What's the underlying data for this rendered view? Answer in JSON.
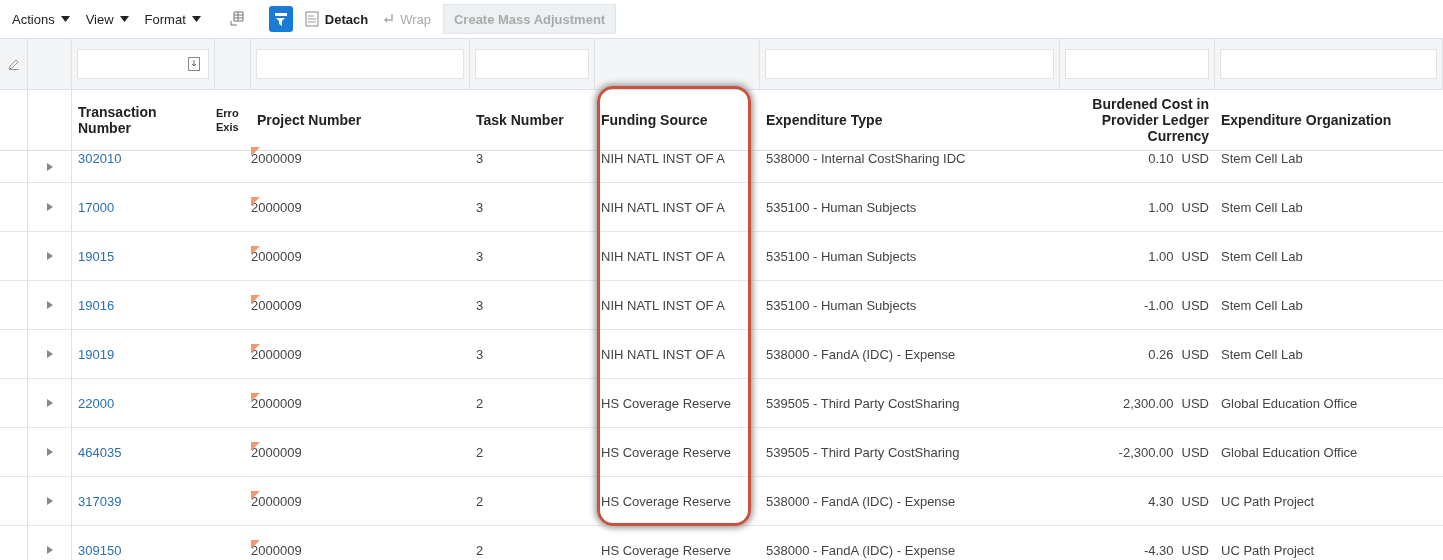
{
  "toolbar": {
    "menus": [
      {
        "label": "Actions"
      },
      {
        "label": "View"
      },
      {
        "label": "Format"
      }
    ],
    "buttons": [
      {
        "kind": "freeze"
      },
      {
        "kind": "filter",
        "selected": true
      },
      {
        "kind": "detach",
        "label": "Detach",
        "disabled": false
      },
      {
        "kind": "wrap",
        "label": "Wrap",
        "disabled": true
      },
      {
        "kind": "text",
        "label": "Create Mass Adjustment",
        "disabled": true
      }
    ]
  },
  "columns": [
    {
      "label": "Transaction Number",
      "filterable": true
    },
    {
      "label": "Erro Exis",
      "filterable": false
    },
    {
      "label": "Project Number",
      "filterable": true
    },
    {
      "label": "Task Number",
      "filterable": true
    },
    {
      "label": "Funding Source",
      "filterable": false,
      "highlighted": true
    },
    {
      "label": "Expenditure Type",
      "filterable": true
    },
    {
      "label": "Burdened Cost in Provider Ledger Currency",
      "filterable": true
    },
    {
      "label": "Expenditure Organization",
      "filterable": true
    }
  ],
  "rows": [
    {
      "transaction": "302010",
      "error": true,
      "project": "2000009",
      "task": "3",
      "funding": "NIH NATL INST OF A",
      "type": "538000 - Internal CostSharing IDC",
      "amount": "0.10",
      "currency": "USD",
      "org": "Stem Cell Lab"
    },
    {
      "transaction": "17000",
      "error": true,
      "project": "2000009",
      "task": "3",
      "funding": "NIH NATL INST OF A",
      "type": "535100 - Human Subjects",
      "amount": "1.00",
      "currency": "USD",
      "org": "Stem Cell Lab"
    },
    {
      "transaction": "19015",
      "error": true,
      "project": "2000009",
      "task": "3",
      "funding": "NIH NATL INST OF A",
      "type": "535100 - Human Subjects",
      "amount": "1.00",
      "currency": "USD",
      "org": "Stem Cell Lab"
    },
    {
      "transaction": "19016",
      "error": true,
      "project": "2000009",
      "task": "3",
      "funding": "NIH NATL INST OF A",
      "type": "535100 - Human Subjects",
      "amount": "-1.00",
      "currency": "USD",
      "org": "Stem Cell Lab"
    },
    {
      "transaction": "19019",
      "error": true,
      "project": "2000009",
      "task": "3",
      "funding": "NIH NATL INST OF A",
      "type": "538000 - FandA (IDC) - Expense",
      "amount": "0.26",
      "currency": "USD",
      "org": "Stem Cell Lab"
    },
    {
      "transaction": "22000",
      "error": true,
      "project": "2000009",
      "task": "2",
      "funding": "HS Coverage Reserve",
      "type": "539505 - Third Party CostSharing",
      "amount": "2,300.00",
      "currency": "USD",
      "org": "Global Education Office"
    },
    {
      "transaction": "464035",
      "error": true,
      "project": "2000009",
      "task": "2",
      "funding": "HS Coverage Reserve",
      "type": "539505 - Third Party CostSharing",
      "amount": "-2,300.00",
      "currency": "USD",
      "org": "Global Education Office"
    },
    {
      "transaction": "317039",
      "error": true,
      "project": "2000009",
      "task": "2",
      "funding": "HS Coverage Reserve",
      "type": "538000 - FandA (IDC) - Expense",
      "amount": "4.30",
      "currency": "USD",
      "org": "UC Path Project"
    },
    {
      "transaction": "309150",
      "error": true,
      "project": "2000009",
      "task": "2",
      "funding": "HS Coverage Reserve",
      "type": "538000 - FandA (IDC) - Expense",
      "amount": "-4.30",
      "currency": "USD",
      "org": "UC Path Project"
    }
  ]
}
